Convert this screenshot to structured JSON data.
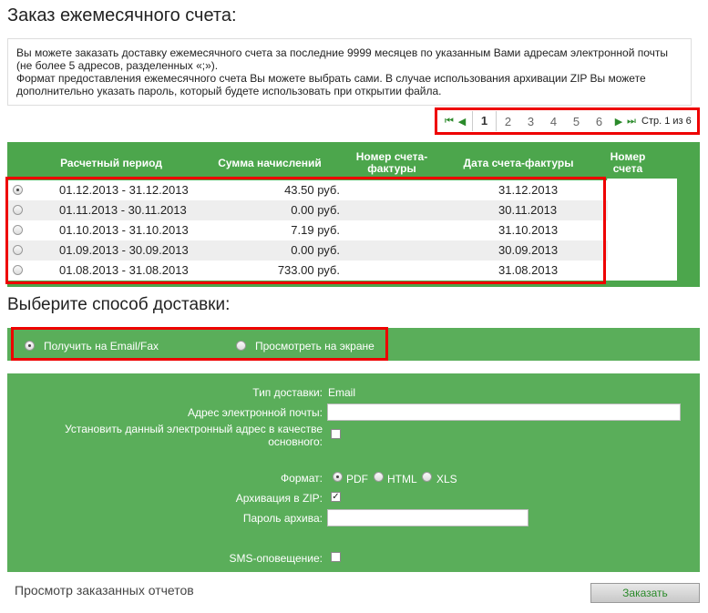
{
  "title": "Заказ ежемесячного счета:",
  "info": {
    "line1": "Вы можете заказать доставку ежемесячного счета за последние 9999 месяцев по указанным Вами адресам электронной почты (не более 5 адресов, разделенных «;»).",
    "line2": "Формат предоставления ежемесячного счета Вы можете выбрать сами. В случае использования архивации ZIP Вы можете дополнительно указать пароль, который будете использовать при открытии файла."
  },
  "pager": {
    "pages": [
      "1",
      "2",
      "3",
      "4",
      "5",
      "6"
    ],
    "active_page": "1",
    "label": "Стр. 1 из 6"
  },
  "table": {
    "headers": [
      "Расчетный период",
      "Сумма начислений",
      "Номер счета-фактуры",
      "Дата счета-фактуры",
      "Номер счета"
    ],
    "rows": [
      {
        "period": "01.12.2013 - 31.12.2013",
        "amount": "43.50 руб.",
        "date": "31.12.2013"
      },
      {
        "period": "01.11.2013 - 30.11.2013",
        "amount": "0.00 руб.",
        "date": "30.11.2013"
      },
      {
        "period": "01.10.2013 - 31.10.2013",
        "amount": "7.19 руб.",
        "date": "31.10.2013"
      },
      {
        "period": "01.09.2013 - 30.09.2013",
        "amount": "0.00 руб.",
        "date": "30.09.2013"
      },
      {
        "period": "01.08.2013 - 31.08.2013",
        "amount": "733.00 руб.",
        "date": "31.08.2013"
      }
    ]
  },
  "delivery": {
    "heading": "Выберите способ доставки:",
    "option_email": "Получить на Email/Fax",
    "option_screen": "Просмотреть на экране"
  },
  "form": {
    "type_label": "Тип доставки:",
    "type_value": "Email",
    "email_label": "Адрес электронной почты:",
    "email_value": "",
    "default_label_1": "Установить данный электронный адрес в качестве",
    "default_label_2": "основного:",
    "format_label": "Формат:",
    "format_pdf": "PDF",
    "format_html": "HTML",
    "format_xls": "XLS",
    "zip_label": "Архивация в ZIP:",
    "password_label": "Пароль архива:",
    "password_value": "",
    "sms_label": "SMS-оповещение:"
  },
  "footer": {
    "link": "Просмотр заказанных отчетов",
    "order_button": "Заказать"
  },
  "colors": {
    "green": "#4ca64c",
    "highlight": "#e00000"
  }
}
